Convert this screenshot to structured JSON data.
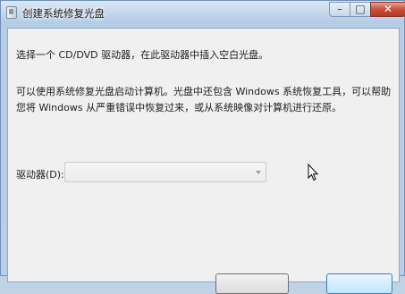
{
  "window": {
    "title": "创建系统修复光盘",
    "controls": {
      "minimize": "–",
      "maximize": "□",
      "close": "✕"
    }
  },
  "body": {
    "instruction": "选择一个 CD/DVD 驱动器，在此驱动器中插入空白光盘。",
    "description": "可以使用系统修复光盘启动计算机。光盘中还包含 Windows 系统恢复工具，可以帮助您将 Windows 从严重错误中恢复过来，或从系统映像对计算机进行还原。"
  },
  "drive": {
    "label": "驱动器(D):",
    "value": ""
  }
}
